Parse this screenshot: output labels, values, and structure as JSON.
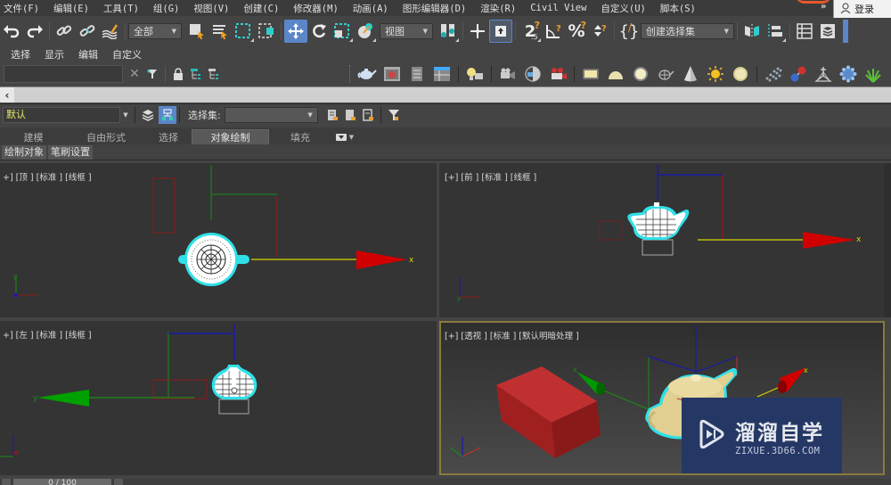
{
  "menubar": {
    "items": [
      "文件(F)",
      "编辑(E)",
      "工具(T)",
      "组(G)",
      "视图(V)",
      "创建(C)",
      "修改器(M)",
      "动画(A)",
      "图形编辑器(D)",
      "渲染(R)",
      "Civil View",
      "自定义(U)",
      "脚本(S)"
    ],
    "more": "»",
    "login": "登录"
  },
  "toolbar": {
    "selection_filter": "全部",
    "ref_coord": "视图",
    "named_selection": "创建选择集",
    "icons": [
      "undo-icon",
      "redo-icon",
      "link-icon",
      "unlink-icon",
      "bind-space-warp-icon",
      "select-object-icon",
      "select-by-name-icon",
      "rect-selection-icon",
      "window-crossing-icon",
      "move-icon",
      "rotate-icon",
      "scale-icon",
      "place-icon",
      "pivot-icon",
      "manipulate-icon",
      "snap-toggle-icon",
      "angle-snap-icon",
      "percent-snap-icon",
      "spinner-snap-icon",
      "edit-named-selection-icon",
      "mirror-icon",
      "align-icon",
      "scene-explorer-icon",
      "layer-explorer-icon"
    ],
    "snap_label": "2.5"
  },
  "scene_explorer": {
    "menu": [
      "选择",
      "显示",
      "编辑",
      "自定义"
    ],
    "search_value": "",
    "search_placeholder": ""
  },
  "create_panel_icons": [
    "teapot-icon",
    "render-frame-icon",
    "list-icon",
    "table-icon",
    "light-icon",
    "camera-icon",
    "camera-target-icon",
    "camera-red-icon",
    "plane-icon",
    "hemisphere-icon",
    "sphere-icon",
    "teapot-wire-icon",
    "cone-icon",
    "sun-icon",
    "disc-icon",
    "particles-icon",
    "molecule-icon",
    "helper-icon",
    "geosphere-icon",
    "foliage-icon"
  ],
  "layer_row": {
    "layer_name": "默认",
    "selset_label": "选择集:",
    "selset_value": ""
  },
  "ribbon": {
    "tabs": [
      "建模",
      "自由形式",
      "选择",
      "对象绘制",
      "填充"
    ],
    "active_tab": "对象绘制",
    "sub_buttons": [
      "绘制对象",
      "笔刷设置"
    ]
  },
  "viewports": [
    {
      "label": "+] [顶 ] [标准 ] [线框 ]",
      "view": "top"
    },
    {
      "label": "[+] [前 ] [标准 ] [线框 ]",
      "view": "front"
    },
    {
      "label": "+] [左 ] [标准 ] [线框 ]",
      "view": "left"
    },
    {
      "label": "[+] [透视 ] [标准 ] [默认明暗处理 ]",
      "view": "perspective"
    }
  ],
  "watermark": {
    "title": "溜溜自学",
    "url": "ZIXUE.3D66.COM"
  },
  "timeline": {
    "value": "0 / 100"
  },
  "colors": {
    "accent_blue": "#5b86c8",
    "axis_x": "#cc0000",
    "axis_y": "#009900",
    "axis_z": "#1a1aaa",
    "selection_cyan": "#30e0e8",
    "active_viewport_border": "#8a7a3c",
    "layer_text": "#e6e66a"
  }
}
